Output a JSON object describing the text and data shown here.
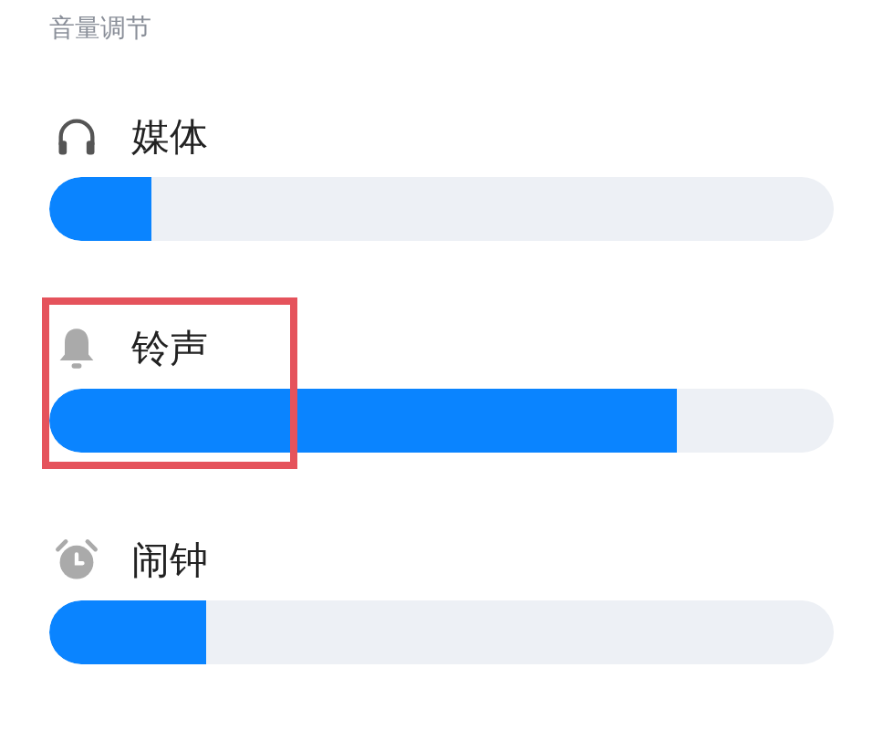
{
  "section_title": "音量调节",
  "channels": [
    {
      "name": "媒体",
      "level": 0.13,
      "highlighted": false
    },
    {
      "name": "铃声",
      "level": 0.8,
      "highlighted": true
    },
    {
      "name": "闹钟",
      "level": 0.2,
      "highlighted": false
    }
  ]
}
